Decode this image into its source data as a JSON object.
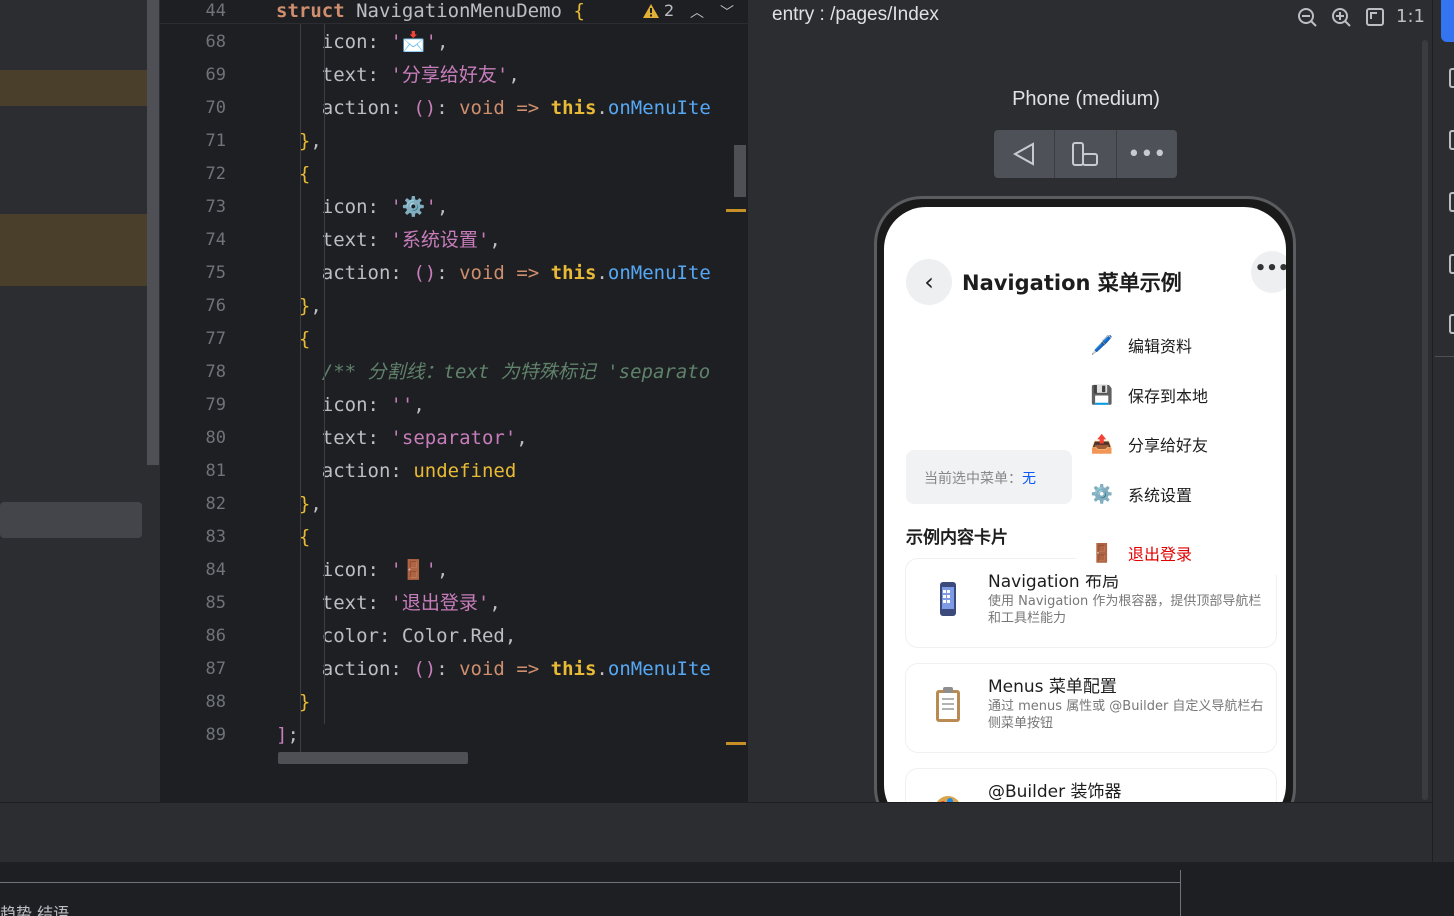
{
  "editor": {
    "sticky": {
      "line": "44",
      "text_kw": "struct",
      "text_name": "NavigationMenuDemo",
      "text_brace": "{"
    },
    "warnings": "2",
    "lines": [
      {
        "n": "68",
        "indent": 6,
        "segments": [
          [
            "plain",
            "icon: "
          ],
          [
            "str",
            "'📩'"
          ],
          [
            "plain",
            ","
          ]
        ]
      },
      {
        "n": "69",
        "indent": 6,
        "segments": [
          [
            "plain",
            "text: "
          ],
          [
            "str",
            "'分享给好友'"
          ],
          [
            "plain",
            ","
          ]
        ]
      },
      {
        "n": "70",
        "indent": 6,
        "segments": [
          [
            "plain",
            "action: "
          ],
          [
            "br2",
            "()"
          ],
          [
            "plain",
            ": "
          ],
          [
            "kw",
            "void"
          ],
          [
            "plain",
            " "
          ],
          [
            "kw",
            "=>"
          ],
          [
            "plain",
            " "
          ],
          [
            "this",
            "this"
          ],
          [
            "plain",
            "."
          ],
          [
            "fn",
            "onMenuIte"
          ]
        ]
      },
      {
        "n": "71",
        "indent": 4,
        "segments": [
          [
            "br",
            "}"
          ],
          [
            "plain",
            ","
          ]
        ]
      },
      {
        "n": "72",
        "indent": 4,
        "segments": [
          [
            "br",
            "{"
          ]
        ]
      },
      {
        "n": "73",
        "indent": 6,
        "segments": [
          [
            "plain",
            "icon: "
          ],
          [
            "str",
            "'⚙️'"
          ],
          [
            "plain",
            ","
          ]
        ]
      },
      {
        "n": "74",
        "indent": 6,
        "segments": [
          [
            "plain",
            "text: "
          ],
          [
            "str",
            "'系统设置'"
          ],
          [
            "plain",
            ","
          ]
        ]
      },
      {
        "n": "75",
        "indent": 6,
        "segments": [
          [
            "plain",
            "action: "
          ],
          [
            "br2",
            "()"
          ],
          [
            "plain",
            ": "
          ],
          [
            "kw",
            "void"
          ],
          [
            "plain",
            " "
          ],
          [
            "kw",
            "=>"
          ],
          [
            "plain",
            " "
          ],
          [
            "this",
            "this"
          ],
          [
            "plain",
            "."
          ],
          [
            "fn",
            "onMenuIte"
          ]
        ]
      },
      {
        "n": "76",
        "indent": 4,
        "segments": [
          [
            "br",
            "}"
          ],
          [
            "plain",
            ","
          ]
        ]
      },
      {
        "n": "77",
        "indent": 4,
        "segments": [
          [
            "br",
            "{"
          ]
        ]
      },
      {
        "n": "78",
        "indent": 6,
        "segments": [
          [
            "cm",
            "/** 分割线：text 为特殊标记 'separato"
          ]
        ]
      },
      {
        "n": "79",
        "indent": 6,
        "segments": [
          [
            "plain",
            "icon: "
          ],
          [
            "str",
            "''"
          ],
          [
            "plain",
            ","
          ]
        ]
      },
      {
        "n": "80",
        "indent": 6,
        "segments": [
          [
            "plain",
            "text: "
          ],
          [
            "str",
            "'separator'"
          ],
          [
            "plain",
            ","
          ]
        ]
      },
      {
        "n": "81",
        "indent": 6,
        "segments": [
          [
            "plain",
            "action: "
          ],
          [
            "undef",
            "undefined"
          ]
        ]
      },
      {
        "n": "82",
        "indent": 4,
        "segments": [
          [
            "br",
            "}"
          ],
          [
            "plain",
            ","
          ]
        ]
      },
      {
        "n": "83",
        "indent": 4,
        "segments": [
          [
            "br",
            "{"
          ]
        ]
      },
      {
        "n": "84",
        "indent": 6,
        "segments": [
          [
            "plain",
            "icon: "
          ],
          [
            "str",
            "'🚪'"
          ],
          [
            "plain",
            ","
          ]
        ]
      },
      {
        "n": "85",
        "indent": 6,
        "segments": [
          [
            "plain",
            "text: "
          ],
          [
            "str",
            "'退出登录'"
          ],
          [
            "plain",
            ","
          ]
        ]
      },
      {
        "n": "86",
        "indent": 6,
        "segments": [
          [
            "plain",
            "color: Color.Red,"
          ]
        ]
      },
      {
        "n": "87",
        "indent": 6,
        "segments": [
          [
            "plain",
            "action: "
          ],
          [
            "br2",
            "()"
          ],
          [
            "plain",
            ": "
          ],
          [
            "kw",
            "void"
          ],
          [
            "plain",
            " "
          ],
          [
            "kw",
            "=>"
          ],
          [
            "plain",
            " "
          ],
          [
            "this",
            "this"
          ],
          [
            "plain",
            "."
          ],
          [
            "fn",
            "onMenuIte"
          ]
        ]
      },
      {
        "n": "88",
        "indent": 4,
        "segments": [
          [
            "br",
            "}"
          ]
        ]
      },
      {
        "n": "89",
        "indent": 2,
        "segments": [
          [
            "br2",
            "]"
          ],
          [
            "plain",
            ";"
          ]
        ]
      }
    ]
  },
  "preview": {
    "title": "entry : /pages/Index",
    "tools": [
      "zoom-out-icon",
      "zoom-in-icon",
      "fit-icon",
      "actual-size-icon"
    ],
    "actual_size_label": "1:1",
    "device_name": "Phone (medium)",
    "app": {
      "nav_title": "Navigation 菜单示例",
      "current_label": "当前选中菜单：",
      "current_value": "无",
      "section_title": "示例内容卡片",
      "menu": [
        {
          "icon": "🖊️",
          "label": "编辑资料",
          "color": "#1d1d1d"
        },
        {
          "icon": "💾",
          "label": "保存到本地",
          "color": "#1d1d1d"
        },
        {
          "icon": "📤",
          "label": "分享给好友",
          "color": "#1d1d1d"
        },
        {
          "icon": "⚙️",
          "label": "系统设置",
          "color": "#1d1d1d"
        },
        {
          "icon": "🚪",
          "label": "退出登录",
          "color": "#e30000"
        }
      ],
      "cards": [
        {
          "icon": "phone-icon",
          "title": "Navigation 布局",
          "desc": "使用 Navigation 作为根容器，提供顶部导航栏和工具栏能力"
        },
        {
          "icon": "clipboard-icon",
          "title": "Menus 菜单配置",
          "desc": "通过 menus 属性或 @Builder 自定义导航栏右侧菜单按钮"
        },
        {
          "icon": "palette-icon",
          "title": "@Builder 装饰器",
          "desc": ""
        }
      ]
    }
  },
  "bottom": {
    "text": "趋势   结语"
  },
  "colors": {
    "accent": "#3574f0",
    "warning": "#c69026",
    "menu_red": "#e30000",
    "link_blue": "#0a59f7"
  }
}
